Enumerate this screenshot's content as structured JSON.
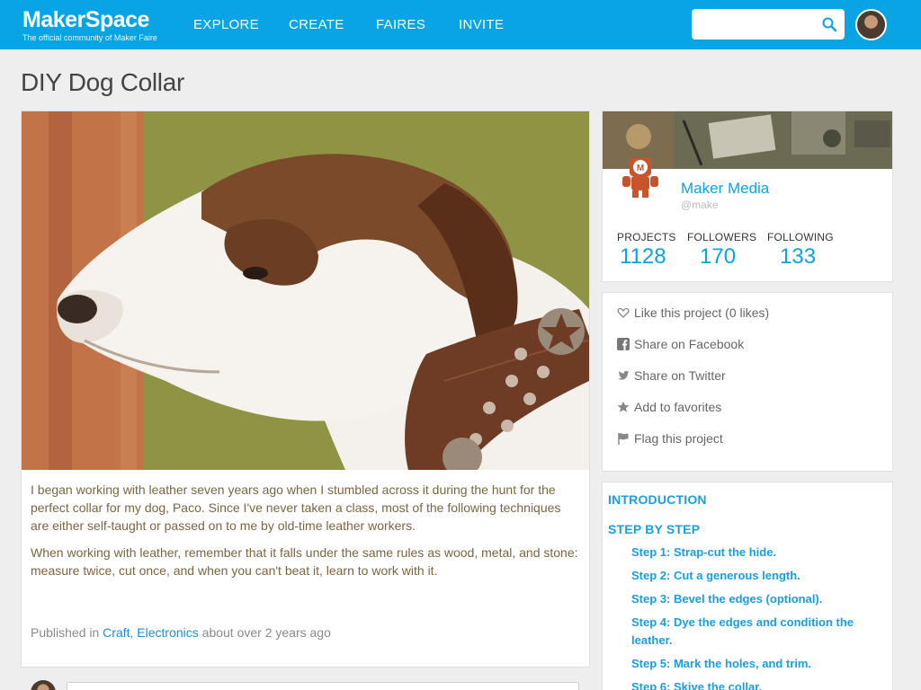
{
  "header": {
    "brand_name": "MakerSpace",
    "brand_tagline": "The official community of Maker Faire",
    "nav": [
      "EXPLORE",
      "CREATE",
      "FAIRES",
      "INVITE"
    ],
    "search_placeholder": "",
    "accent_color": "#09a4e3"
  },
  "project": {
    "title": "DIY Dog Collar",
    "description": [
      "I began working with leather seven years ago when I stumbled across it during the hunt for the perfect collar for my dog, Paco. Since I've never taken a class, most of the following techniques are either self-taught or passed on to me by old-time leather workers.",
      "When working with leather, remember that it falls under the same rules as wood, metal, and stone: measure twice, cut once, and when you can't beat it, learn to work with it."
    ],
    "published_prefix": "Published in",
    "categories": [
      "Craft",
      "Electronics"
    ],
    "published_when": "about over 2 years ago"
  },
  "author": {
    "name": "Maker Media",
    "handle": "@make",
    "stats": [
      {
        "label": "PROJECTS",
        "value": "1128"
      },
      {
        "label": "FOLLOWERS",
        "value": "170"
      },
      {
        "label": "FOLLOWING",
        "value": "133"
      }
    ]
  },
  "actions": [
    {
      "label": "Like this project (0 likes)",
      "icon": "heart-icon"
    },
    {
      "label": "Share  on  Facebook",
      "icon": "facebook-icon"
    },
    {
      "label": "Share  on  Twitter",
      "icon": "twitter-icon"
    },
    {
      "label": "Add to favorites",
      "icon": "star-icon"
    },
    {
      "label": "Flag  this  project",
      "icon": "flag-icon"
    }
  ],
  "toc": {
    "intro_label": "INTRODUCTION",
    "steps_label": "STEP BY STEP",
    "steps": [
      "Step 1: Strap-cut the hide.",
      "Step 2: Cut a generous length.",
      "Step 3: Bevel the edges (optional).",
      "Step 4: Dye the edges and condition the leather.",
      "Step 5: Mark the holes, and trim.",
      "Step 6: Skive the collar."
    ]
  }
}
